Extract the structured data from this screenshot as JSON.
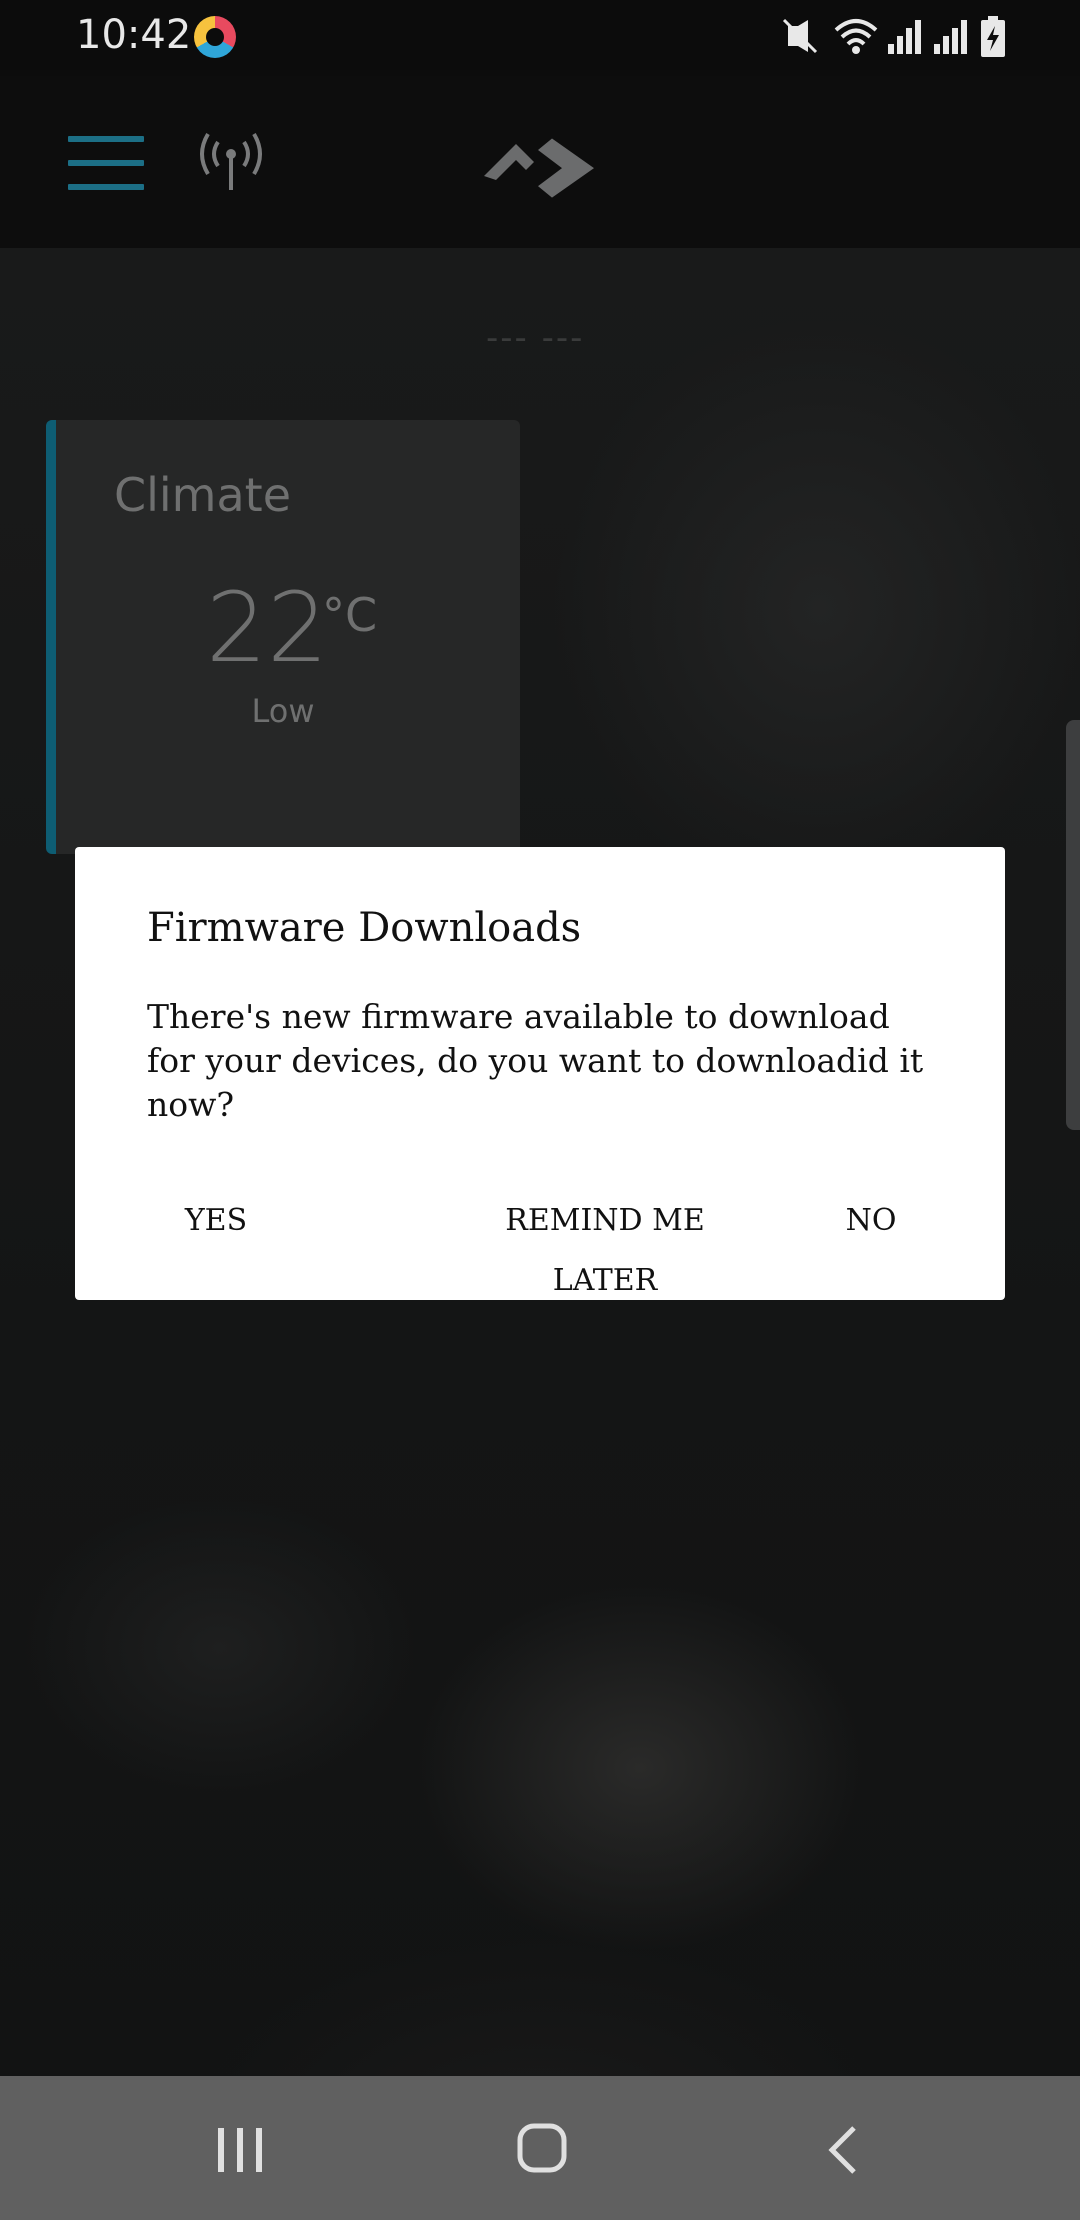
{
  "status_bar": {
    "time": "10:42",
    "icons": [
      "app-notification-icon",
      "mute-vibrate-icon",
      "wifi-icon",
      "signal-icon",
      "signal-icon",
      "battery-charging-icon"
    ]
  },
  "toolbar": {
    "icons": [
      "menu-icon",
      "antenna-icon",
      "brand-logo-icon"
    ],
    "accent_color": "#1c6f86"
  },
  "placeholder_title": "--- ---",
  "climate": {
    "title": "Climate",
    "temperature": "22",
    "unit": "°C",
    "mode": "Low"
  },
  "dialog": {
    "title": "Firmware Downloads",
    "message": "There's new firmware available to download for your devices, do you want to downloadid it now?",
    "buttons": {
      "yes": "YES",
      "remind_later": "REMIND ME LATER",
      "no": "NO"
    }
  },
  "nav_bar": {
    "icons": [
      "recents-icon",
      "home-icon",
      "back-icon"
    ]
  }
}
